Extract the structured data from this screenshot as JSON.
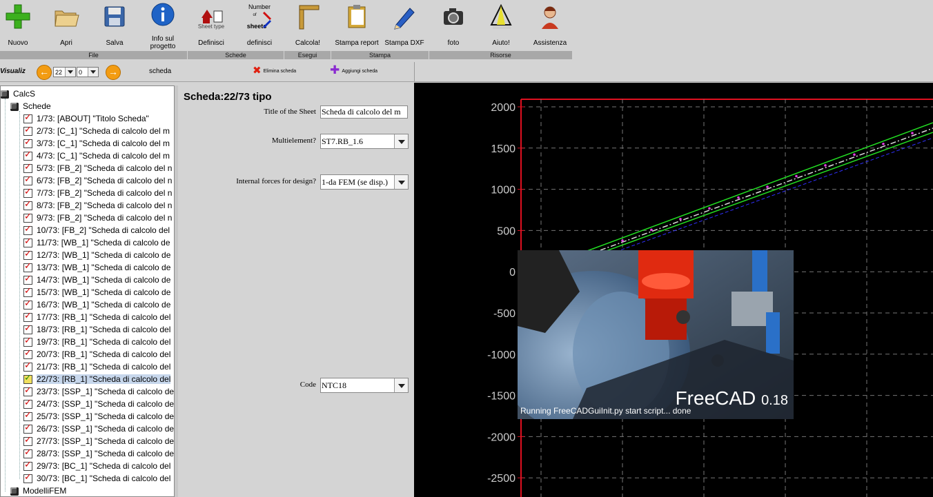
{
  "toolbar": {
    "buttons": [
      {
        "label": "Nuovo"
      },
      {
        "label": "Apri"
      },
      {
        "label": "Salva"
      },
      {
        "label": "Info sul progetto"
      },
      {
        "label": "Definisci",
        "icon_caption": "Sheet type"
      },
      {
        "label": "definisci",
        "icon_caption_top": "Number",
        "icon_caption_mid": "of",
        "icon_caption_bottom": "sheets"
      },
      {
        "label": "Calcola!"
      },
      {
        "label": "Stampa report"
      },
      {
        "label": "Stampa DXF"
      },
      {
        "label": "foto"
      },
      {
        "label": "Aiuto!"
      },
      {
        "label": "Assistenza"
      }
    ],
    "groups": [
      "File",
      "Schede",
      "Esegui",
      "Stampa",
      "Risorse"
    ]
  },
  "nav": {
    "visualizza": "Visualiz",
    "sheet_number": "22",
    "sheet_sub": "0",
    "scheda": "scheda",
    "delete_label": "Elimina scheda",
    "add_label": "Aggiungi scheda"
  },
  "tree": {
    "root": "CalcS",
    "schede": "Schede",
    "modelli": "ModelliFEM",
    "items": [
      "1/73: [ABOUT] \"Titolo Scheda\"",
      "2/73: [C_1] \"Scheda di calcolo del m",
      "3/73: [C_1] \"Scheda di calcolo del m",
      "4/73: [C_1] \"Scheda di calcolo del m",
      "5/73: [FB_2] \"Scheda di calcolo del n",
      "6/73: [FB_2] \"Scheda di calcolo del n",
      "7/73: [FB_2] \"Scheda di calcolo del n",
      "8/73: [FB_2] \"Scheda di calcolo del n",
      "9/73: [FB_2] \"Scheda di calcolo del n",
      "10/73: [FB_2] \"Scheda di calcolo del",
      "11/73: [WB_1] \"Scheda di calcolo de",
      "12/73: [WB_1] \"Scheda di calcolo de",
      "13/73: [WB_1] \"Scheda di calcolo de",
      "14/73: [WB_1] \"Scheda di calcolo de",
      "15/73: [WB_1] \"Scheda di calcolo de",
      "16/73: [WB_1] \"Scheda di calcolo de",
      "17/73: [RB_1] \"Scheda di calcolo del",
      "18/73: [RB_1] \"Scheda di calcolo del",
      "19/73: [RB_1] \"Scheda di calcolo del",
      "20/73: [RB_1] \"Scheda di calcolo del",
      "21/73: [RB_1] \"Scheda di calcolo del",
      "22/73: [RB_1] \"Scheda di calcolo del",
      "23/73: [SSP_1] \"Scheda di calcolo de",
      "24/73: [SSP_1] \"Scheda di calcolo de",
      "25/73: [SSP_1] \"Scheda di calcolo de",
      "26/73: [SSP_1] \"Scheda di calcolo de",
      "27/73: [SSP_1] \"Scheda di calcolo de",
      "28/73: [SSP_1] \"Scheda di calcolo de",
      "29/73: [BC_1] \"Scheda di calcolo del",
      "30/73: [BC_1] \"Scheda di calcolo del"
    ],
    "selected_index": 21
  },
  "form": {
    "title": "Scheda:22/73 tipo",
    "title_label": "Title of the Sheet",
    "title_value": "Scheda di calcolo del m",
    "multielement_label": "Multielement?",
    "multielement_value": "ST7.RB_1.6",
    "forces_label": "Internal forces for design?",
    "forces_value": "1-da FEM (se disp.)",
    "code_label": "Code",
    "code_value": "NTC18"
  },
  "plot": {
    "y_ticks": [
      "2000",
      "1500",
      "1000",
      "500",
      "0",
      "-500",
      "-1000",
      "-1500",
      "-2000",
      "-2500"
    ]
  },
  "splash": {
    "brand": "FreeCAD",
    "version": "0.18",
    "status": "Running FreeCADGuiInit.py start script... done"
  },
  "colors": {
    "accent_orange": "#f39c12",
    "grid_red": "#e01020",
    "beam_green": "#22dd22"
  }
}
